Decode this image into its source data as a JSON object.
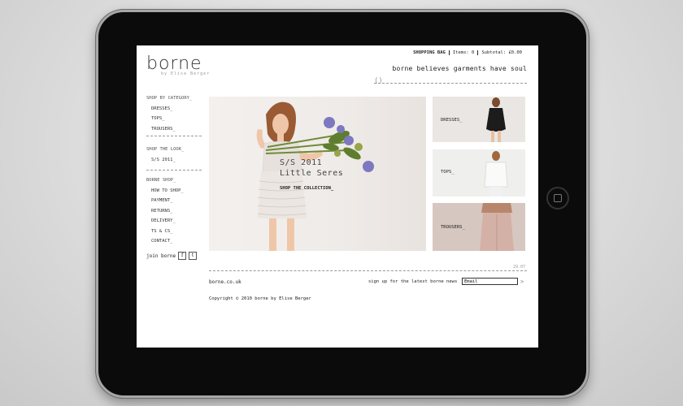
{
  "logo": {
    "name": "borne",
    "sub": "by Elise Berger"
  },
  "bag": {
    "label": "SHOPPING BAG",
    "items": "Items: 0",
    "subtotal": "Subtotal: £0.00"
  },
  "tagline": "borne believes garments have soul",
  "paren": "()",
  "nav": {
    "category_head": "SHOP BY CATEGORY_",
    "categories": [
      "DRESSES_",
      "TOPS_",
      "TROUSERS_"
    ],
    "look_head": "SHOP THE LOOK_",
    "looks": [
      "S/S 2011_"
    ],
    "shop_head": "BORNE SHOP_",
    "shop": [
      "HOW TO SHOP_",
      "PAYMENT_",
      "RETURNS_",
      "DELIVERY_",
      "TS & CS_",
      "CONTACT_"
    ]
  },
  "join": {
    "label": "join borne",
    "facebook": "f",
    "twitter": "t"
  },
  "hero": {
    "line1": "S/S 2011",
    "line2": "Little Seres",
    "cta": "SHOP THE COLLECTION_"
  },
  "tiles": [
    "DRESSES_",
    "TOPS_",
    "TROUSERS_"
  ],
  "pager": "29.07",
  "footer": {
    "site": "borne.co.uk",
    "signup": "sign up for the latest borne news",
    "email_value": "Email",
    "go": ">",
    "copyright": "Copyright © 2010 borne by Elise Berger"
  }
}
